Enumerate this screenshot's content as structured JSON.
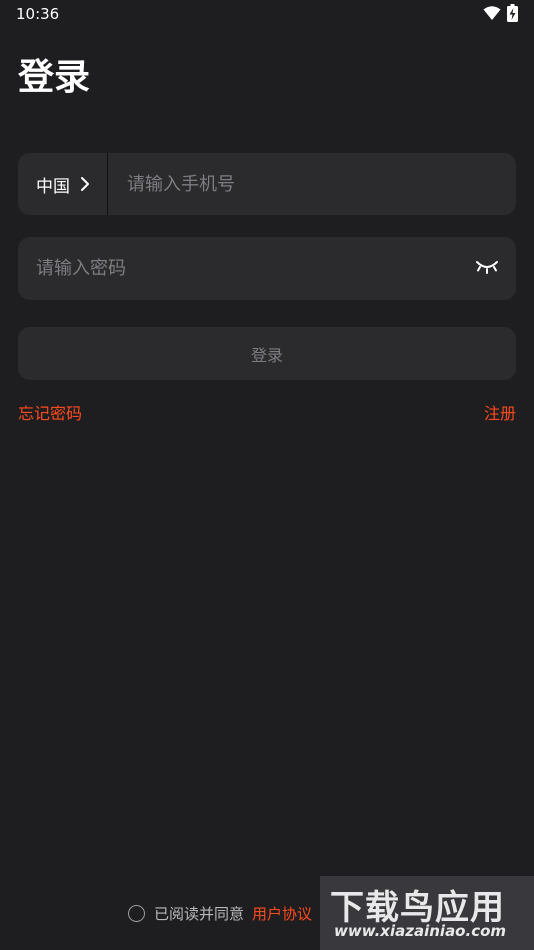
{
  "status_bar": {
    "time": "10:36"
  },
  "page": {
    "title": "登录"
  },
  "phone": {
    "country": "中国",
    "placeholder": "请输入手机号"
  },
  "password": {
    "placeholder": "请输入密码"
  },
  "login_button": "登录",
  "links": {
    "forgot": "忘记密码",
    "register": "注册"
  },
  "agreement": {
    "text": "已阅读并同意",
    "terms": "用户协议"
  },
  "watermark": {
    "title": "下载鸟应用",
    "url": "www.xiazainiao.com"
  },
  "colors": {
    "background": "#1e1e20",
    "field": "#2b2b2e",
    "accent": "#ff4a1c"
  }
}
